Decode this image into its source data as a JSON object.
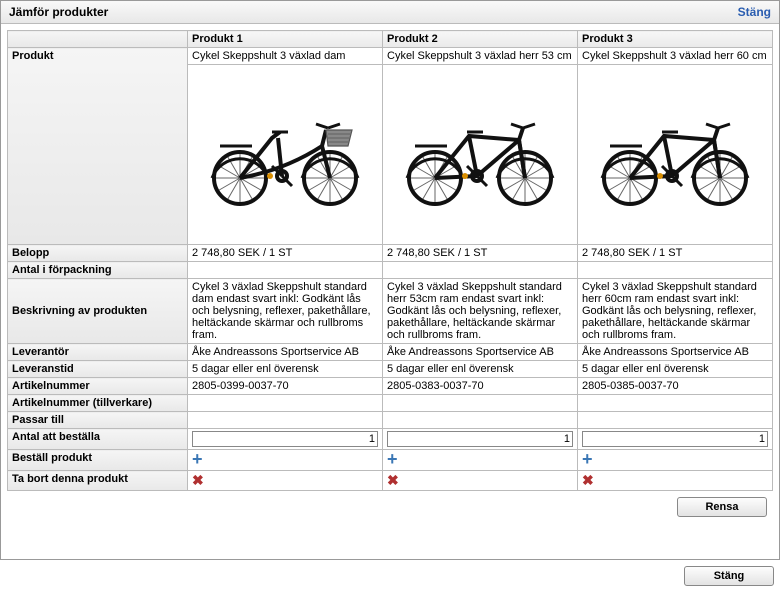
{
  "header": {
    "title": "Jämför produkter",
    "close": "Stäng"
  },
  "columns": {
    "attr_header": "",
    "p1": "Produkt 1",
    "p2": "Produkt 2",
    "p3": "Produkt 3"
  },
  "row_labels": {
    "produkt": "Produkt",
    "belopp": "Belopp",
    "antal_forpackning": "Antal i förpackning",
    "beskrivning": "Beskrivning av produkten",
    "leverantor": "Leverantör",
    "leveranstid": "Leveranstid",
    "artikelnummer": "Artikelnummer",
    "artikelnummer_tillverkare": "Artikelnummer (tillverkare)",
    "passar_till": "Passar till",
    "antal_att_bestalla": "Antal att beställa",
    "bestall_produkt": "Beställ produkt",
    "ta_bort": "Ta bort denna produkt"
  },
  "products": {
    "p1": {
      "name": "Cykel Skeppshult 3 växlad dam",
      "style": "step-through",
      "has_basket": true,
      "belopp": "2 748,80 SEK  / 1 ST",
      "antal_forpackning": "",
      "beskrivning": "Cykel 3 växlad Skeppshult standard dam endast svart inkl: Godkänt lås och belysning, reflexer, pakethållare, heltäckande skärmar och rullbroms fram.",
      "leverantor": "Åke Andreassons Sportservice AB",
      "leveranstid": "5 dagar eller enl överensk",
      "artikelnummer": "2805-0399-0037-70",
      "artikelnummer_tillverkare": "",
      "passar_till": "",
      "qty": "1"
    },
    "p2": {
      "name": "Cykel Skeppshult 3 växlad herr 53 cm",
      "style": "diamond",
      "has_basket": false,
      "belopp": "2 748,80 SEK  / 1 ST",
      "antal_forpackning": "",
      "beskrivning": "Cykel 3 växlad Skeppshult standard herr 53cm ram endast svart inkl: Godkänt lås och belysning, reflexer, pakethållare, heltäckande skärmar och rullbroms fram.",
      "leverantor": "Åke Andreassons Sportservice AB",
      "leveranstid": "5 dagar eller enl överensk",
      "artikelnummer": "2805-0383-0037-70",
      "artikelnummer_tillverkare": "",
      "passar_till": "",
      "qty": "1"
    },
    "p3": {
      "name": "Cykel Skeppshult 3 växlad herr 60 cm",
      "style": "diamond",
      "has_basket": false,
      "belopp": "2 748,80 SEK  / 1 ST",
      "antal_forpackning": "",
      "beskrivning": "Cykel 3 växlad Skeppshult standard herr 60cm ram endast svart inkl: Godkänt lås och belysning, reflexer, pakethållare, heltäckande skärmar och rullbroms fram.",
      "leverantor": "Åke Andreassons Sportservice AB",
      "leveranstid": "5 dagar eller enl överensk",
      "artikelnummer": "2805-0385-0037-70",
      "artikelnummer_tillverkare": "",
      "passar_till": "",
      "qty": "1"
    }
  },
  "buttons": {
    "rensa": "Rensa",
    "stang": "Stäng"
  },
  "icons": {
    "plus": "plus-icon",
    "cross": "cross-icon"
  }
}
